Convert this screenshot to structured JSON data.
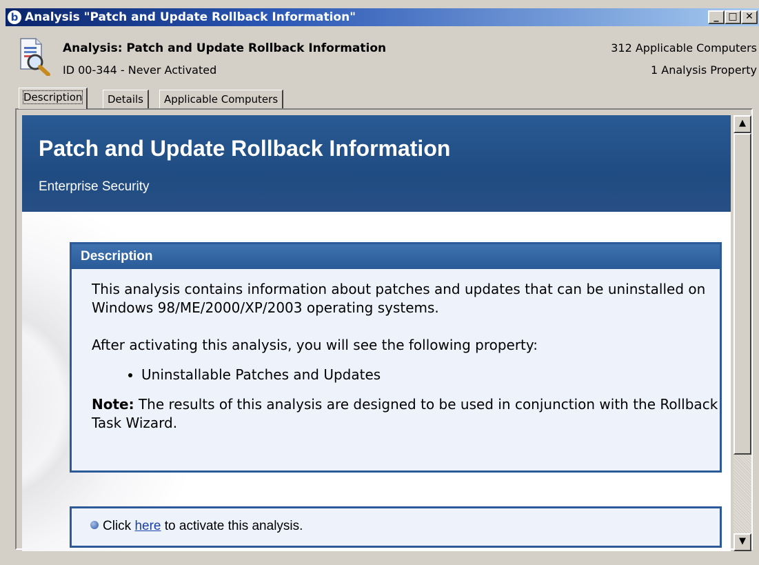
{
  "window": {
    "title": "Analysis \"Patch and Update Rollback Information\"",
    "app_icon": "b",
    "controls": {
      "minimize": "_",
      "maximize": "□",
      "close": "✕"
    }
  },
  "header": {
    "title": "Analysis: Patch and Update Rollback Information",
    "subtitle": "ID 00-344 - Never Activated",
    "applicable_computers": "312 Applicable Computers",
    "properties": "1 Analysis Property",
    "icon": "analysis-document-magnifier-icon"
  },
  "tabs": [
    {
      "label": "Description",
      "active": true
    },
    {
      "label": "Details",
      "active": false
    },
    {
      "label": "Applicable Computers",
      "active": false
    }
  ],
  "banner": {
    "title": "Patch and Update Rollback Information",
    "subtitle": "Enterprise Security"
  },
  "description": {
    "heading": "Description",
    "paragraph1": "This analysis contains information about patches and updates that can be uninstalled on Windows 98/ME/2000/XP/2003 operating systems.",
    "paragraph2": "After activating this analysis, you will see the following property:",
    "list": [
      "Uninstallable Patches and Updates"
    ],
    "note_label": "Note:",
    "note_text": " The results of this analysis are designed to be used in conjunction with the Rollback Task Wizard."
  },
  "activate": {
    "prefix": "Click ",
    "link": "here",
    "suffix": " to activate this analysis."
  },
  "scrollbar": {
    "up": "▲",
    "down": "▼"
  },
  "colors": {
    "banner": "#1f4c82",
    "box_border": "#2c5a98",
    "box_bg": "#eef3fb",
    "link": "#1a3fa8"
  }
}
